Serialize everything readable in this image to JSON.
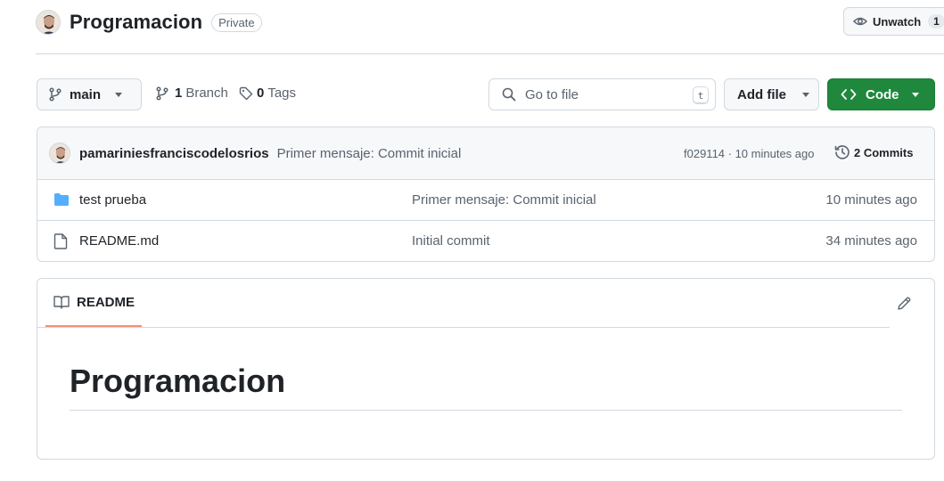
{
  "repo": {
    "name": "Programacion",
    "visibility": "Private",
    "unwatch_label": "Unwatch",
    "watch_count": "1"
  },
  "toolbar": {
    "branch": "main",
    "branch_count": "1",
    "branch_word": "Branch",
    "tag_count": "0",
    "tag_word": "Tags",
    "search_placeholder": "Go to file",
    "search_shortcut": "t",
    "add_file_label": "Add file",
    "code_label": "Code"
  },
  "commit_bar": {
    "author": "pamariniesfranciscodelosrios",
    "message": "Primer mensaje: Commit inicial",
    "hash_time": "f029114 · 10 minutes ago",
    "commits_label": "2 Commits"
  },
  "files": [
    {
      "name": "test prueba",
      "type": "folder",
      "commit": "Primer mensaje: Commit inicial",
      "time": "10 minutes ago"
    },
    {
      "name": "README.md",
      "type": "file",
      "commit": "Initial commit",
      "time": "34 minutes ago"
    }
  ],
  "readme": {
    "tab_label": "README",
    "heading": "Programacion"
  },
  "colors": {
    "accent_green": "#1f883d",
    "folder_blue": "#54aeff",
    "tab_underline": "#fd8c73"
  },
  "icons": [
    "eye-icon",
    "branch-icon",
    "tag-icon",
    "search-icon",
    "code-icon",
    "history-icon",
    "folder-icon",
    "file-icon",
    "book-icon",
    "pencil-icon"
  ]
}
